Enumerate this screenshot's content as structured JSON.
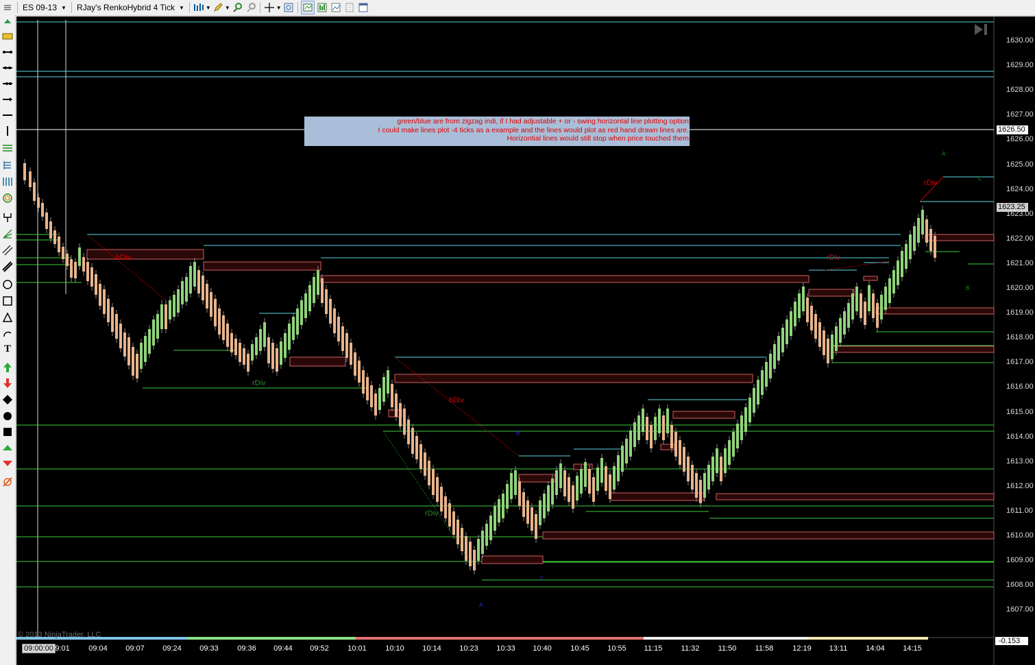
{
  "toolbar": {
    "instrument": "ES 09-13",
    "chart_type": "RJay's RenkoHybrid  4 Tick",
    "icons": [
      "bar-style-icon",
      "drawing-pencil-icon",
      "zoom-in-icon",
      "zoom-out-icon",
      "crosshair-icon",
      "zoom-box-icon",
      "strategy-icon",
      "indicators-icon",
      "chart-trader-icon",
      "properties-icon",
      "data-box-icon"
    ]
  },
  "sidebar_tools": [
    "ruler-icon",
    "line-icon",
    "ray-icon",
    "extended-line-icon",
    "arrow-line-icon",
    "vertical-line-icon",
    "horizontal-line-icon",
    "fibonacci-icon",
    "gann-icon",
    "spiral-icon",
    "andrews-pitchfork-icon",
    "regression-channel-icon",
    "parallel-channel-icon",
    "trend-channel-icon",
    "ellipse-icon",
    "rectangle-icon",
    "triangle-icon",
    "arc-icon",
    "text-icon",
    "arrow-up-icon",
    "arrow-down-icon",
    "diamond-icon",
    "dot-icon",
    "square-icon",
    "triangle-up-icon",
    "triangle-down-icon",
    "remove-drawing-icon"
  ],
  "annotation": {
    "lines": [
      "green/blue are from zigzag indi, if I had adjustable + or - swing horizontal line plotting option",
      "I could make lines plot -4 ticks as a example and the lines would plot as red hand drawn lines are.",
      "Horizontial lines would still stop when price touched them"
    ]
  },
  "price_axis": {
    "labels": [
      "1630.00",
      "1629.00",
      "1628.00",
      "1627.00",
      "1626.00",
      "1625.00",
      "1624.00",
      "1623.00",
      "1622.00",
      "1621.00",
      "1620.00",
      "1619.00",
      "1618.00",
      "1617.00",
      "1616.00",
      "1615.00",
      "1614.00",
      "1613.00",
      "1612.00",
      "1611.00",
      "1610.00",
      "1609.00",
      "1608.00",
      "1607.00"
    ],
    "current_price": "1623.25",
    "marker_price": "1626.50",
    "bottom_value": "-0.153"
  },
  "time_axis": {
    "start": "09:00:00",
    "labels": [
      "09:01",
      "09:04",
      "09:07",
      "09:24",
      "09:33",
      "09:36",
      "09:44",
      "09:52",
      "10:01",
      "10:10",
      "10:14",
      "10:23",
      "10:33",
      "10:40",
      "10:45",
      "10:55",
      "11:15",
      "11:32",
      "11:50",
      "11:58",
      "12:19",
      "13:11",
      "14:04",
      "14:15"
    ]
  },
  "chart_text": {
    "hdiv1": "hDiv",
    "rdiv1": "rDiv",
    "hdiv2": "hDiv",
    "rdiv2": "rDiv",
    "rdiv3": "rDiv",
    "rdiv4": "rDiv",
    "a_top": "A",
    "b_mid": "B",
    "c_right": "C",
    "a_low": "A",
    "b_low": "B",
    "c_low": "C"
  },
  "copyright": "© 2013 NinjaTrader, LLC",
  "colors": {
    "background": "#000000",
    "up_bar": "#8fd47a",
    "down_bar": "#e8b48c",
    "zigzag_low_line": "#3bd13b",
    "zigzag_high_line": "#5ad8e6",
    "hand_drawn_box": "#d06060",
    "hdiv": "#e00000",
    "rdiv": "#2e8b2e"
  }
}
